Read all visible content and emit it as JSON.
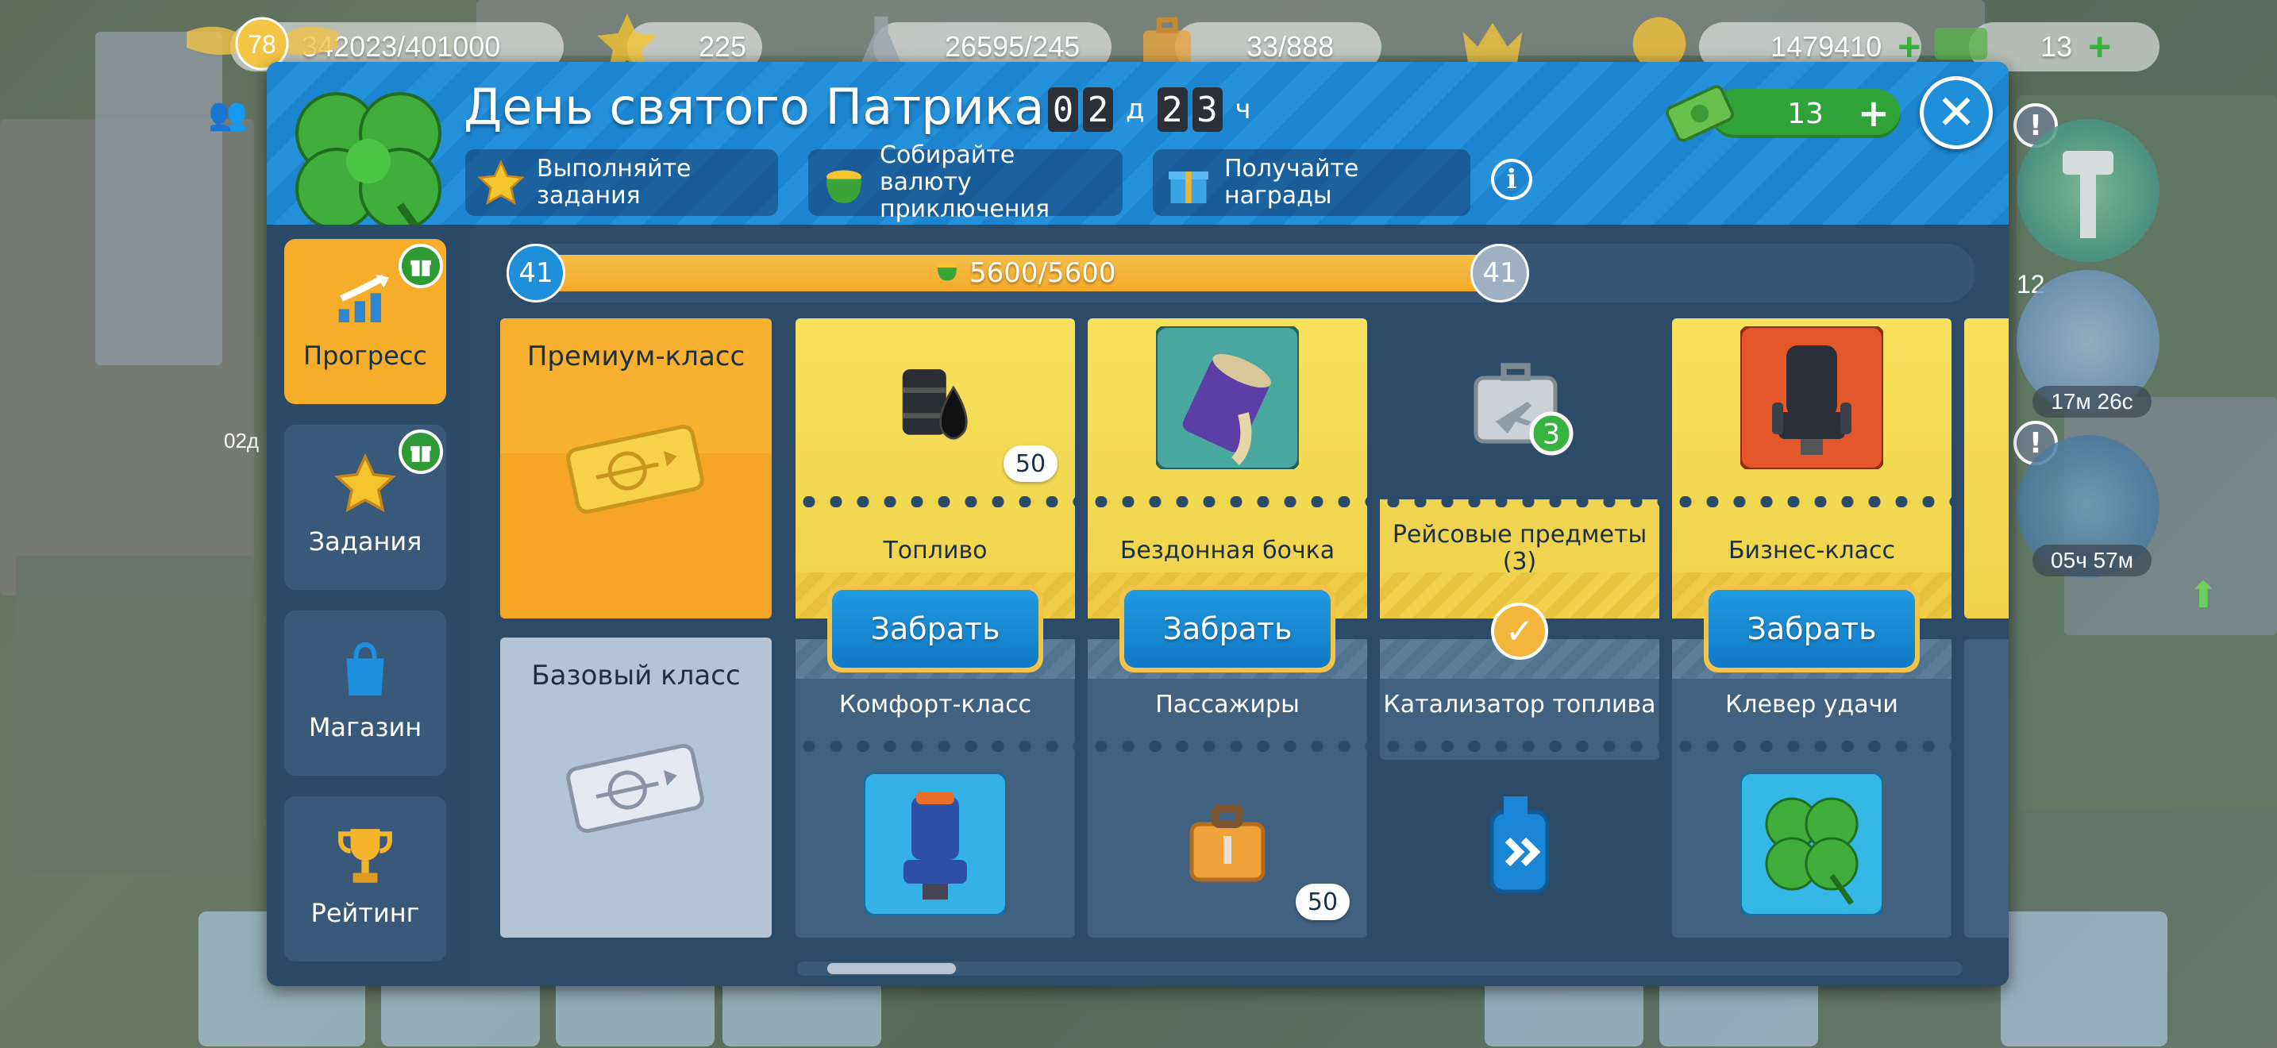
{
  "hud": {
    "level": "78",
    "xp": "342023/401000",
    "stars": "225",
    "fuel": "26595/245",
    "passengers": "33/888",
    "coins": "1479410",
    "cash": "13"
  },
  "side": {
    "tower_badge": "12",
    "radar_timer": "17м 26с",
    "speed_timer": "05ч 57м",
    "left_timer": "02д"
  },
  "event": {
    "title": "День святого Патрика",
    "timer": {
      "days_digits": [
        "0",
        "2"
      ],
      "days_unit": "д",
      "hours_digits": [
        "2",
        "3"
      ],
      "hours_unit": "ч"
    },
    "steps": [
      {
        "label": "Выполняйте задания",
        "icon": "star-icon"
      },
      {
        "label": "Собирайте валюту приключения",
        "icon": "pot-of-gold-icon"
      },
      {
        "label": "Получайте награды",
        "icon": "gift-icon"
      }
    ],
    "currency_value": "13"
  },
  "nav": {
    "items": [
      {
        "label": "Прогресс",
        "icon": "chart-arrow-icon",
        "active": true,
        "badge": true
      },
      {
        "label": "Задания",
        "icon": "star-icon",
        "active": false,
        "badge": true
      },
      {
        "label": "Магазин",
        "icon": "shopping-bag-icon",
        "active": false,
        "badge": false
      },
      {
        "label": "Рейтинг",
        "icon": "trophy-icon",
        "active": false,
        "badge": false
      }
    ]
  },
  "progress": {
    "level_current": "41",
    "level_next": "41",
    "text": "5600/5600",
    "fraction": 1.0
  },
  "tiers": {
    "premium": "Премиум-класс",
    "basic": "Базовый класс"
  },
  "claim_label": "Забрать",
  "rewards": [
    {
      "premium": {
        "name": "Топливо",
        "qty": "50",
        "icon": "fuel-barrel-icon",
        "claimable": true
      },
      "basic": {
        "name": "Комфорт-класс",
        "icon": "comfort-seat-icon"
      }
    },
    {
      "premium": {
        "name": "Бездонная бочка",
        "icon": "bottomless-barrel-icon",
        "claimable": true
      },
      "basic": {
        "name": "Пассажиры",
        "qty": "50",
        "icon": "suitcase-icon"
      }
    },
    {
      "premium": {
        "name": "Рейсовые предметы (3)",
        "icon": "flight-case-icon",
        "claimed": true
      },
      "basic": {
        "name": "Катализатор топлива",
        "icon": "fuel-canister-icon"
      }
    },
    {
      "premium": {
        "name": "Бизнес-класс",
        "icon": "business-seat-icon",
        "claimable": true
      },
      "basic": {
        "name": "Клевер удачи",
        "icon": "clover-icon"
      }
    }
  ],
  "colors": {
    "modal_bg": "#2f4f6e",
    "header_blue": "#1d84cf",
    "gold": "#f6ad2c",
    "button_blue": "#1278c4",
    "green": "#2fa23a"
  }
}
